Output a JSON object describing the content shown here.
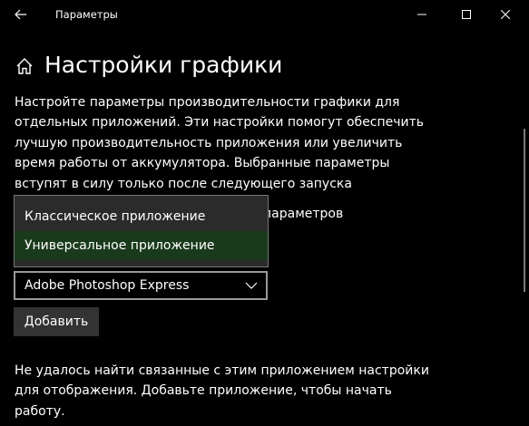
{
  "titlebar": {
    "title": "Параметры",
    "back_icon": "arrow-left-icon",
    "minimize_icon": "minimize-icon",
    "maximize_icon": "maximize-icon",
    "close_icon": "close-icon"
  },
  "page": {
    "title": "Настройки графики",
    "home_icon": "home-icon",
    "description": "Настройте параметры производительности графики для отдельных приложений. Эти настройки помогут обеспечить лучшую производительность приложения или увеличить время работы от аккумулятора. Выбранные параметры вступят в силу только после следующего запуска приложения."
  },
  "app_type": {
    "label_visible_fragment": "параметров",
    "options": [
      {
        "label": "Классическое приложение",
        "selected": false
      },
      {
        "label": "Универсальное приложение",
        "selected": true
      }
    ]
  },
  "app_select": {
    "value": "Adobe Photoshop Express",
    "chevron_icon": "chevron-down-icon"
  },
  "add_button": {
    "label": "Добавить"
  },
  "message": "Не удалось найти связанные с этим приложением настройки для отображения. Добавьте приложение, чтобы начать работу.",
  "colors": {
    "background": "#000000",
    "text": "#ffffff",
    "dropdown_bg": "#2b2b2b",
    "dropdown_selected": "#1a3a1c",
    "button_bg": "#333333"
  }
}
